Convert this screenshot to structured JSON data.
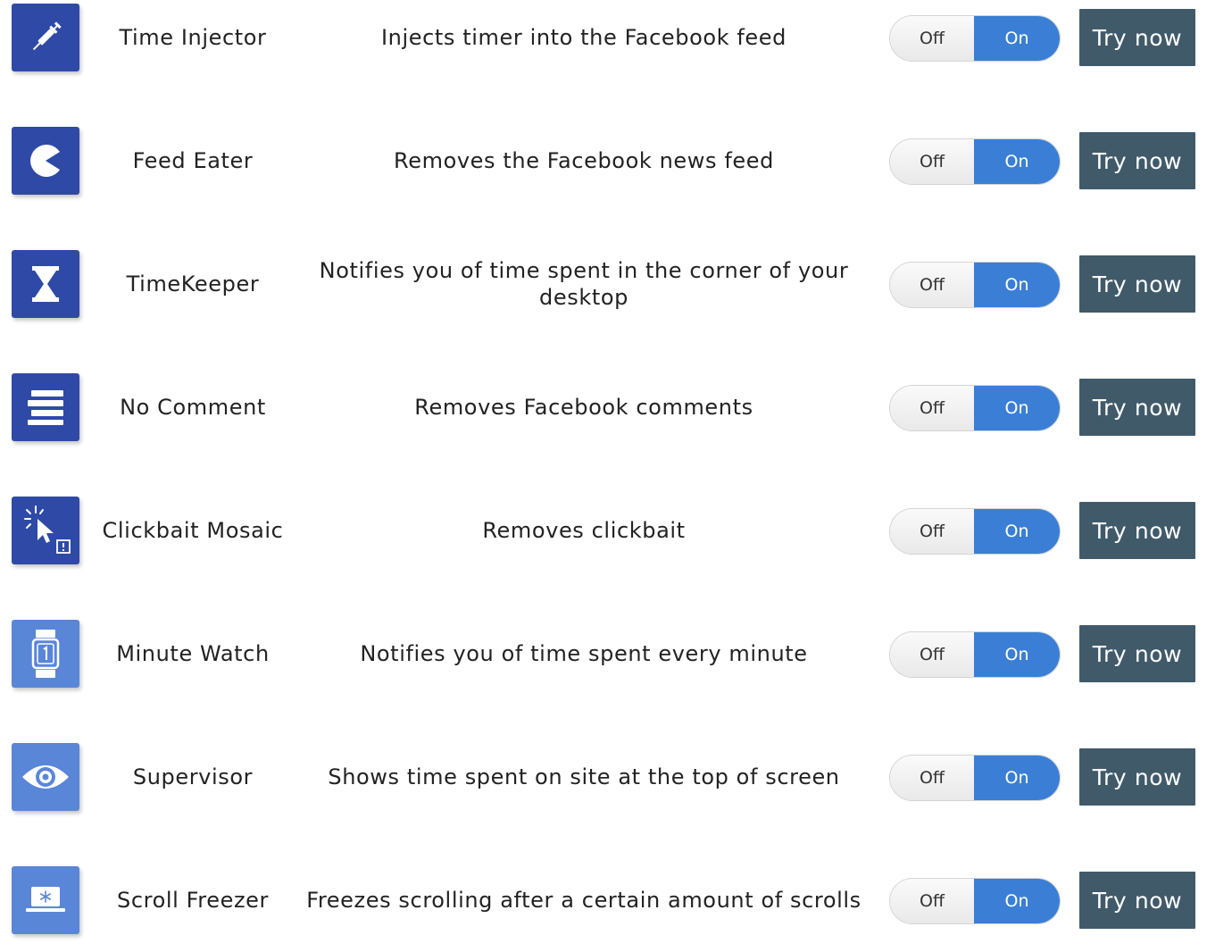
{
  "colors": {
    "icon_dark": "#2e4aa6",
    "icon_light": "#5a86d8",
    "toggle_on": "#3a7fd5",
    "try_button": "#405a6a"
  },
  "features": [
    {
      "icon": "syringe-icon",
      "name": "Time Injector",
      "description": "Injects timer into the Facebook feed",
      "toggle_off": "Off",
      "toggle_on": "On",
      "state": "on",
      "try_label": "Try now"
    },
    {
      "icon": "pacman-icon",
      "name": "Feed Eater",
      "description": "Removes the Facebook news feed",
      "toggle_off": "Off",
      "toggle_on": "On",
      "state": "on",
      "try_label": "Try now"
    },
    {
      "icon": "hourglass-icon",
      "name": "TimeKeeper",
      "description": "Notifies you of time spent in the corner of your desktop",
      "toggle_off": "Off",
      "toggle_on": "On",
      "state": "on",
      "try_label": "Try now"
    },
    {
      "icon": "list-icon",
      "name": "No Comment",
      "description": "Removes Facebook comments",
      "toggle_off": "Off",
      "toggle_on": "On",
      "state": "on",
      "try_label": "Try now"
    },
    {
      "icon": "cursor-click-icon",
      "name": "Clickbait Mosaic",
      "description": "Removes clickbait",
      "toggle_off": "Off",
      "toggle_on": "On",
      "state": "on",
      "try_label": "Try now"
    },
    {
      "icon": "watch-icon",
      "name": "Minute Watch",
      "description": "Notifies you of time spent every minute",
      "toggle_off": "Off",
      "toggle_on": "On",
      "state": "on",
      "try_label": "Try now"
    },
    {
      "icon": "eye-icon",
      "name": "Supervisor",
      "description": "Shows time spent on site at the top of screen",
      "toggle_off": "Off",
      "toggle_on": "On",
      "state": "on",
      "try_label": "Try now"
    },
    {
      "icon": "laptop-snowflake-icon",
      "name": "Scroll Freezer",
      "description": "Freezes scrolling after a certain amount of scrolls",
      "toggle_off": "Off",
      "toggle_on": "On",
      "state": "on",
      "try_label": "Try now"
    }
  ]
}
